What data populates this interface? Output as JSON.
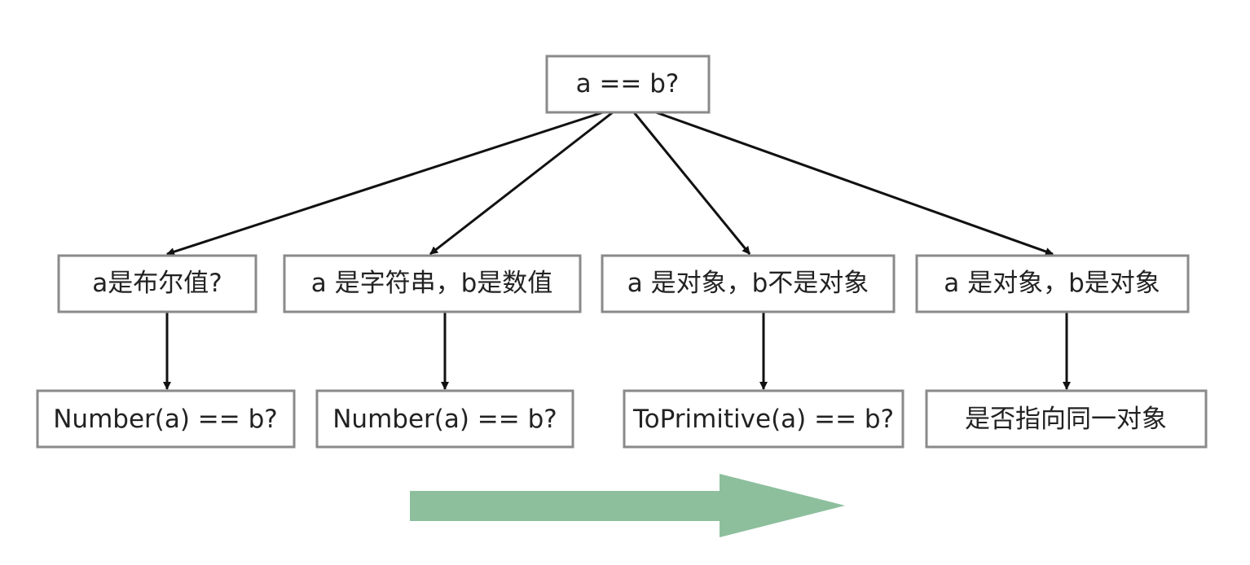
{
  "diagram": {
    "root": {
      "label": "a == b?"
    },
    "branches": [
      {
        "condition": "a是布尔值?",
        "result": "Number(a) == b?"
      },
      {
        "condition": "a 是字符串，b是数值",
        "result": "Number(a) == b?"
      },
      {
        "condition": "a 是对象，b不是对象",
        "result": "ToPrimitive(a) == b?"
      },
      {
        "condition": "a 是对象，b是对象",
        "result": "是否指向同一对象"
      }
    ],
    "colors": {
      "box_border": "#8a8a8a",
      "edge": "#111111",
      "big_arrow": "#8dbf9d",
      "text": "#222222"
    }
  }
}
